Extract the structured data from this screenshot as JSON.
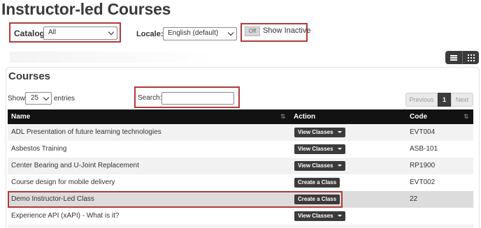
{
  "page": {
    "title": "Instructor-led Courses"
  },
  "filters": {
    "catalog_label": "Catalog:",
    "catalog_value": "All",
    "locale_label": "Locale:",
    "locale_value": "English (default)",
    "toggle_state": "Off",
    "toggle_label": "Show Inactive"
  },
  "section": {
    "title": "Courses"
  },
  "table_controls": {
    "show_label": "Show",
    "entries_value": "25",
    "entries_label": "entries",
    "search_label": "Search:",
    "search_value": ""
  },
  "pagination": {
    "previous": "Previous",
    "current": "1",
    "next": "Next"
  },
  "columns": {
    "name": "Name",
    "action": "Action",
    "code": "Code"
  },
  "rows": [
    {
      "name": "ADL Presentation of future learning technologies",
      "action": "View Classes",
      "code": "EVT004"
    },
    {
      "name": "Asbestos Training",
      "action": "View Classes",
      "code": "ASB-101"
    },
    {
      "name": "Center Bearing and U-Joint Replacement",
      "action": "View Classes",
      "code": "RP1900"
    },
    {
      "name": "Course design for mobile delivery",
      "action": "Create a Class",
      "code": "EVT002"
    },
    {
      "name": "Demo Instructor-Led Class",
      "action": "Create a Class",
      "code": "22"
    },
    {
      "name": "Experience API (xAPI) - What is it?",
      "action": "View Classes",
      "code": ""
    }
  ],
  "colors": {
    "header_bg": "#121212",
    "highlight": "#b03a3a",
    "button_bg": "#3b3b3b"
  },
  "icons": {
    "list_view": "list-icon",
    "grid_view": "grid-icon"
  }
}
